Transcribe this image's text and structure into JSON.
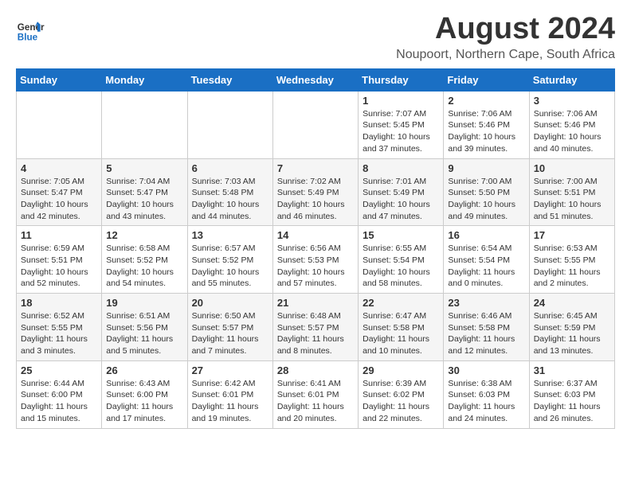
{
  "header": {
    "logo_line1": "General",
    "logo_line2": "Blue",
    "main_title": "August 2024",
    "subtitle": "Noupoort, Northern Cape, South Africa"
  },
  "calendar": {
    "days_of_week": [
      "Sunday",
      "Monday",
      "Tuesday",
      "Wednesday",
      "Thursday",
      "Friday",
      "Saturday"
    ],
    "weeks": [
      [
        {
          "day": "",
          "info": ""
        },
        {
          "day": "",
          "info": ""
        },
        {
          "day": "",
          "info": ""
        },
        {
          "day": "",
          "info": ""
        },
        {
          "day": "1",
          "info": "Sunrise: 7:07 AM\nSunset: 5:45 PM\nDaylight: 10 hours\nand 37 minutes."
        },
        {
          "day": "2",
          "info": "Sunrise: 7:06 AM\nSunset: 5:46 PM\nDaylight: 10 hours\nand 39 minutes."
        },
        {
          "day": "3",
          "info": "Sunrise: 7:06 AM\nSunset: 5:46 PM\nDaylight: 10 hours\nand 40 minutes."
        }
      ],
      [
        {
          "day": "4",
          "info": "Sunrise: 7:05 AM\nSunset: 5:47 PM\nDaylight: 10 hours\nand 42 minutes."
        },
        {
          "day": "5",
          "info": "Sunrise: 7:04 AM\nSunset: 5:47 PM\nDaylight: 10 hours\nand 43 minutes."
        },
        {
          "day": "6",
          "info": "Sunrise: 7:03 AM\nSunset: 5:48 PM\nDaylight: 10 hours\nand 44 minutes."
        },
        {
          "day": "7",
          "info": "Sunrise: 7:02 AM\nSunset: 5:49 PM\nDaylight: 10 hours\nand 46 minutes."
        },
        {
          "day": "8",
          "info": "Sunrise: 7:01 AM\nSunset: 5:49 PM\nDaylight: 10 hours\nand 47 minutes."
        },
        {
          "day": "9",
          "info": "Sunrise: 7:00 AM\nSunset: 5:50 PM\nDaylight: 10 hours\nand 49 minutes."
        },
        {
          "day": "10",
          "info": "Sunrise: 7:00 AM\nSunset: 5:51 PM\nDaylight: 10 hours\nand 51 minutes."
        }
      ],
      [
        {
          "day": "11",
          "info": "Sunrise: 6:59 AM\nSunset: 5:51 PM\nDaylight: 10 hours\nand 52 minutes."
        },
        {
          "day": "12",
          "info": "Sunrise: 6:58 AM\nSunset: 5:52 PM\nDaylight: 10 hours\nand 54 minutes."
        },
        {
          "day": "13",
          "info": "Sunrise: 6:57 AM\nSunset: 5:52 PM\nDaylight: 10 hours\nand 55 minutes."
        },
        {
          "day": "14",
          "info": "Sunrise: 6:56 AM\nSunset: 5:53 PM\nDaylight: 10 hours\nand 57 minutes."
        },
        {
          "day": "15",
          "info": "Sunrise: 6:55 AM\nSunset: 5:54 PM\nDaylight: 10 hours\nand 58 minutes."
        },
        {
          "day": "16",
          "info": "Sunrise: 6:54 AM\nSunset: 5:54 PM\nDaylight: 11 hours\nand 0 minutes."
        },
        {
          "day": "17",
          "info": "Sunrise: 6:53 AM\nSunset: 5:55 PM\nDaylight: 11 hours\nand 2 minutes."
        }
      ],
      [
        {
          "day": "18",
          "info": "Sunrise: 6:52 AM\nSunset: 5:55 PM\nDaylight: 11 hours\nand 3 minutes."
        },
        {
          "day": "19",
          "info": "Sunrise: 6:51 AM\nSunset: 5:56 PM\nDaylight: 11 hours\nand 5 minutes."
        },
        {
          "day": "20",
          "info": "Sunrise: 6:50 AM\nSunset: 5:57 PM\nDaylight: 11 hours\nand 7 minutes."
        },
        {
          "day": "21",
          "info": "Sunrise: 6:48 AM\nSunset: 5:57 PM\nDaylight: 11 hours\nand 8 minutes."
        },
        {
          "day": "22",
          "info": "Sunrise: 6:47 AM\nSunset: 5:58 PM\nDaylight: 11 hours\nand 10 minutes."
        },
        {
          "day": "23",
          "info": "Sunrise: 6:46 AM\nSunset: 5:58 PM\nDaylight: 11 hours\nand 12 minutes."
        },
        {
          "day": "24",
          "info": "Sunrise: 6:45 AM\nSunset: 5:59 PM\nDaylight: 11 hours\nand 13 minutes."
        }
      ],
      [
        {
          "day": "25",
          "info": "Sunrise: 6:44 AM\nSunset: 6:00 PM\nDaylight: 11 hours\nand 15 minutes."
        },
        {
          "day": "26",
          "info": "Sunrise: 6:43 AM\nSunset: 6:00 PM\nDaylight: 11 hours\nand 17 minutes."
        },
        {
          "day": "27",
          "info": "Sunrise: 6:42 AM\nSunset: 6:01 PM\nDaylight: 11 hours\nand 19 minutes."
        },
        {
          "day": "28",
          "info": "Sunrise: 6:41 AM\nSunset: 6:01 PM\nDaylight: 11 hours\nand 20 minutes."
        },
        {
          "day": "29",
          "info": "Sunrise: 6:39 AM\nSunset: 6:02 PM\nDaylight: 11 hours\nand 22 minutes."
        },
        {
          "day": "30",
          "info": "Sunrise: 6:38 AM\nSunset: 6:03 PM\nDaylight: 11 hours\nand 24 minutes."
        },
        {
          "day": "31",
          "info": "Sunrise: 6:37 AM\nSunset: 6:03 PM\nDaylight: 11 hours\nand 26 minutes."
        }
      ]
    ]
  }
}
